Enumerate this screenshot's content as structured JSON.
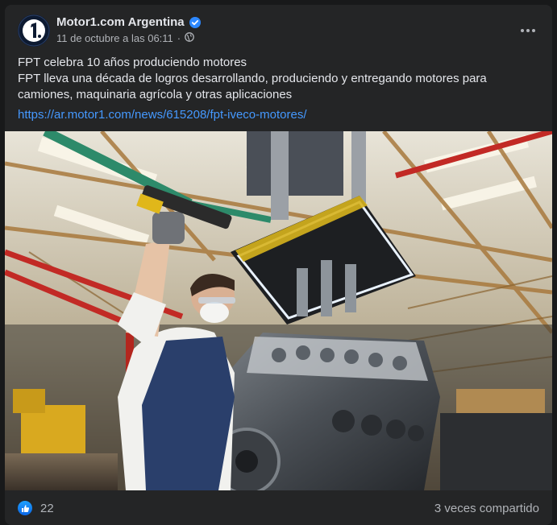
{
  "post": {
    "author": "Motor1.com Argentina",
    "timestamp": "11 de octubre a las 06:11",
    "title": "FPT celebra 10 años produciendo motores",
    "body": "FPT lleva una década de logros desarrollando, produciendo y entregando motores para camiones, maquinaria agrícola y otras aplicaciones",
    "link": "https://ar.motor1.com/news/615208/fpt-iveco-motores/"
  },
  "reactions": {
    "like_count": "22",
    "shares": "3 veces compartido"
  },
  "colors": {
    "card": "#242526",
    "text": "#e4e6eb",
    "muted": "#b0b3b8",
    "link": "#4599ff",
    "verified": "#2d88ff"
  },
  "icons": [
    "motor1-logo-icon",
    "verified-badge-icon",
    "globe-icon",
    "more-options-icon",
    "like-reaction-icon"
  ]
}
